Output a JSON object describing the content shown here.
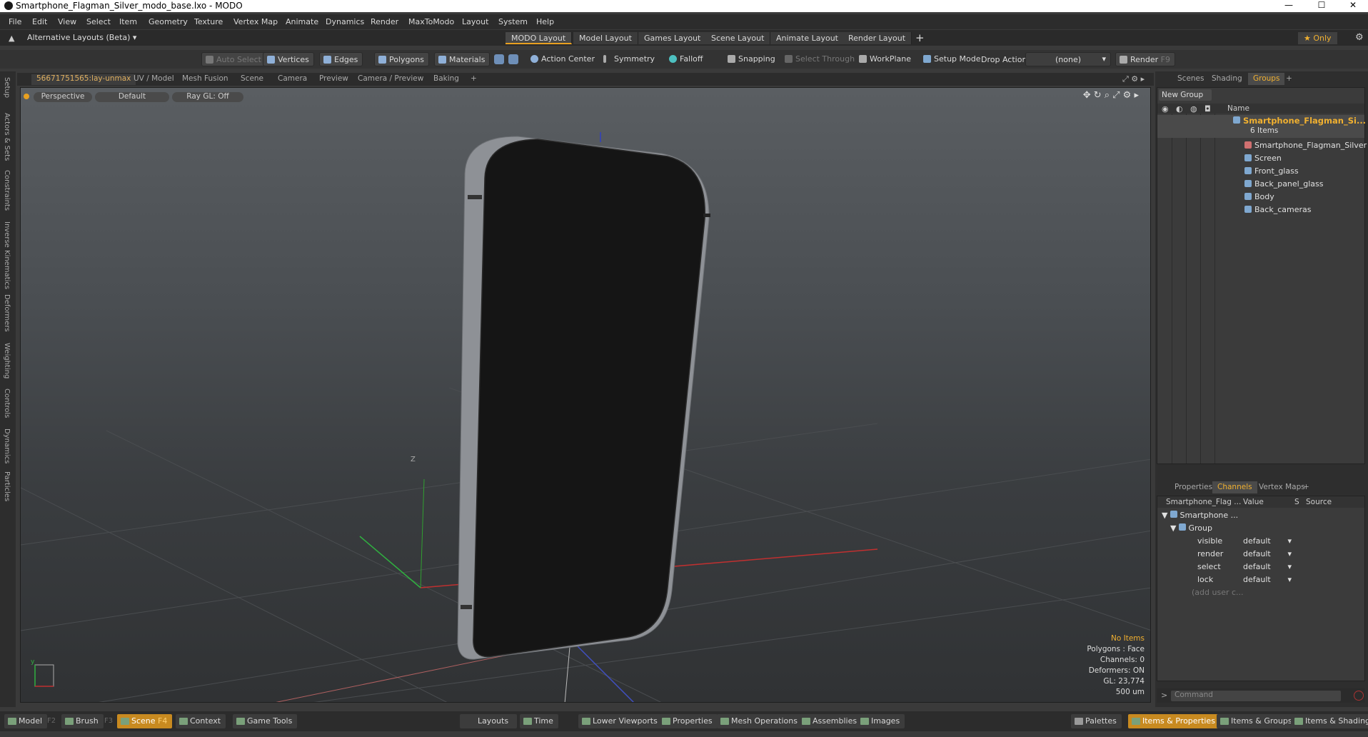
{
  "window": {
    "title": "Smartphone_Flagman_Silver_modo_base.lxo - MODO",
    "min": "—",
    "max": "☐",
    "close": "✕"
  },
  "menu": [
    "File",
    "Edit",
    "View",
    "Select",
    "Item",
    "Geometry",
    "Texture",
    "Vertex Map",
    "Animate",
    "Dynamics",
    "Render",
    "MaxToModo",
    "Layout",
    "System",
    "Help"
  ],
  "layoutbar": {
    "alt_layouts": "Alternative Layouts (Beta) ▾",
    "tabs": [
      "MODO Layout",
      "Model Layout",
      "Games Layout",
      "Scene Layout",
      "Animate Layout",
      "Render Layout"
    ],
    "add": "+",
    "only": "★  Only"
  },
  "toolbar": {
    "auto_select": "Auto Select",
    "vertices": "Vertices",
    "edges": "Edges",
    "polygons": "Polygons",
    "materials": "Materials",
    "action_center": "Action Center",
    "symmetry": "Symmetry",
    "falloff": "Falloff",
    "snapping": "Snapping",
    "select_through": "Select Through",
    "workplane": "WorkPlane",
    "setup_mode": "Setup Mode",
    "drop_action": "Drop Action",
    "drop_value": "(none)",
    "render": "Render",
    "render_key": "F9"
  },
  "left_tabs": [
    "Setup",
    "Actors & Sets",
    "Constraints",
    "Inverse Kinematics",
    "Deformers",
    "Weighting",
    "Controls",
    "Dynamics",
    "Particles"
  ],
  "viewport_tabs": [
    "56671751565:lay-unmax",
    "UV / Model",
    "Mesh Fusion",
    "Scene",
    "Camera",
    "Preview",
    "Camera / Preview",
    "Baking",
    "+"
  ],
  "viewport": {
    "view": "Perspective",
    "style": "Default",
    "raygl": "Ray GL: Off",
    "stats": {
      "items": "No Items",
      "polygons": "Polygons : Face",
      "channels": "Channels: 0",
      "deformers": "Deformers: ON",
      "gl": "GL: 23,774",
      "scale": "500 um"
    }
  },
  "right_tabs_top": [
    "Scenes",
    "Shading",
    "Groups",
    "+"
  ],
  "groups": {
    "new_group": "New Group",
    "name_header": "Name",
    "root": "Smartphone_Flagman_Si...",
    "count": "6 Items",
    "items": [
      "Smartphone_Flagman_Silver",
      "Screen",
      "Front_glass",
      "Back_panel_glass",
      "Body",
      "Back_cameras"
    ]
  },
  "right_tabs_bottom": [
    "Properties",
    "Channels",
    "Vertex Maps",
    "+"
  ],
  "channels": {
    "col_name": "Smartphone_Flag ...",
    "col_value": "Value",
    "col_s": "S",
    "col_source": "Source",
    "root": "Smartphone ...",
    "group": "Group",
    "rows": [
      {
        "name": "visible",
        "value": "default"
      },
      {
        "name": "render",
        "value": "default"
      },
      {
        "name": "select",
        "value": "default"
      },
      {
        "name": "lock",
        "value": "default"
      }
    ],
    "add_user": "(add user c..."
  },
  "command_placeholder": "Command",
  "bottombar": {
    "model": "Model",
    "model_key": "F2",
    "brush": "Brush",
    "brush_key": "F3",
    "scene": "Scene",
    "scene_key": "F4",
    "context": "Context",
    "game_tools": "Game Tools",
    "layouts": "Layouts",
    "time": "Time",
    "lower_viewports": "Lower Viewports",
    "properties": "Properties",
    "mesh_operations": "Mesh Operations",
    "assemblies": "Assemblies",
    "images": "Images",
    "palettes": "Palettes",
    "items_properties": "Items & Properties",
    "items_groups": "Items & Groups",
    "items_shading": "Items & Shading"
  }
}
